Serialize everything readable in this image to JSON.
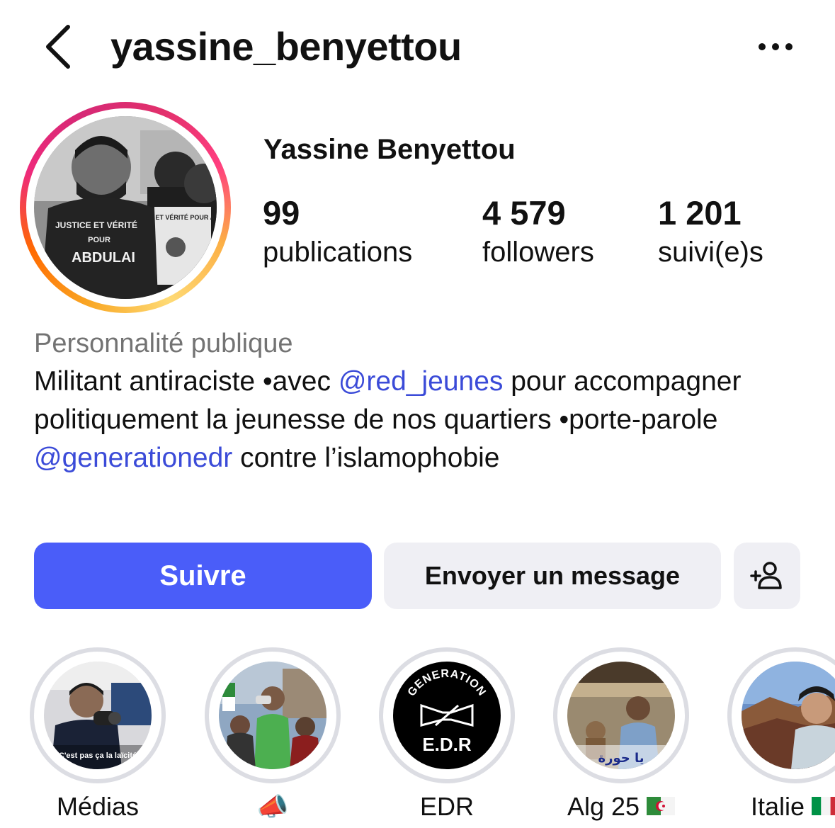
{
  "header": {
    "username": "yassine_benyettou",
    "back_icon": "chevron-left-icon",
    "more_icon": "ellipsis-icon"
  },
  "profile": {
    "display_name": "Yassine Benyettou",
    "stats": [
      {
        "value": "99",
        "label": "publications"
      },
      {
        "value": "4 579",
        "label": "followers"
      },
      {
        "value": "1 201",
        "label": "suivi(e)s"
      }
    ],
    "avatar_shirt_text_1": "JUSTICE ET VÉRITÉ",
    "avatar_shirt_text_2": "POUR",
    "avatar_shirt_text_3": "ABDULAI",
    "avatar_sign_text": "JUSTICE ET VÉRITÉ POUR ABDULAI"
  },
  "bio": {
    "category": "Personnalité publique",
    "line1_a": "Militant antiraciste •avec ",
    "mention1": "@red_jeunes",
    "line1_b": " pour accompagner politiquement la jeunesse de nos quartiers •porte-parole ",
    "mention2": "@generationedr",
    "line1_c": " contre l’islamophobie"
  },
  "actions": {
    "follow_label": "Suivre",
    "message_label": "Envoyer un message",
    "add_user_icon": "add-person-icon"
  },
  "highlights": [
    {
      "label": "Médias",
      "caption": "C'est pas ça la laïcité"
    },
    {
      "label": "📣",
      "caption": ""
    },
    {
      "label": "EDR",
      "caption": "GENERATION E.D.R"
    },
    {
      "label": "Alg 25",
      "caption": "يا حورة"
    },
    {
      "label": "Italie",
      "caption": ""
    }
  ],
  "colors": {
    "follow_button": "#4a5df9",
    "secondary_button": "#efeff4",
    "mention": "#3b4bd8",
    "category_text": "#737373",
    "highlight_ring": "#dcdde3"
  }
}
